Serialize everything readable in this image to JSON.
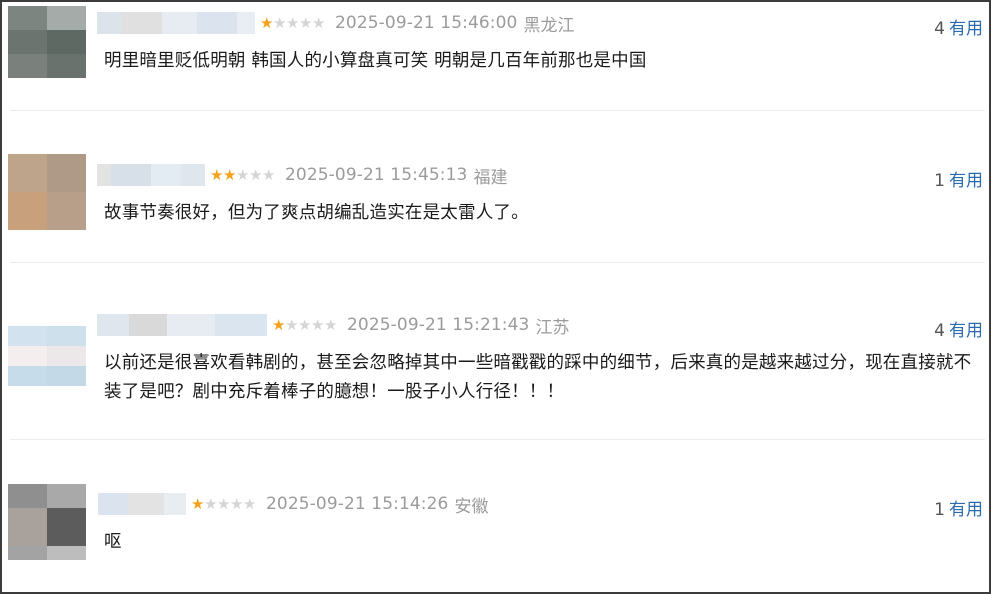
{
  "useful_label": "有用",
  "colors": {
    "star_on": "#f4a21b",
    "star_off": "#d5d5d5",
    "meta_text": "#9b9b9b",
    "link": "#2a6bb0",
    "border": "#3c3c3c"
  },
  "reviews": [
    {
      "stars": 1,
      "time": "2025-09-21 15:46:00",
      "location": "黑龙江",
      "useful_count": "4",
      "content": "明里暗里贬低明朝 韩国人的小算盘真可笑 明朝是几百年前那也是中国",
      "avatar": [
        "#7d8580",
        "#a5aba8",
        "#6c7470",
        "#5f6964",
        "#7a817d",
        "#6a726e"
      ],
      "username_blur": [
        "#dde3ea",
        "#e0e0e0",
        "#e6ecf2",
        "#dbe4ee",
        "#e8eef3"
      ]
    },
    {
      "stars": 2,
      "time": "2025-09-21 15:45:13",
      "location": "福建",
      "useful_count": "1",
      "content": "故事节奏很好，但为了爽点胡编乱造实在是太雷人了。",
      "avatar": [
        "#bfa48c",
        "#ae9a86",
        "#c9a07c",
        "#b79f8a"
      ],
      "username_blur": [
        "#e3e3e3",
        "#d7dfe8",
        "#e4ecf3",
        "#dfe6ee"
      ]
    },
    {
      "stars": 1,
      "time": "2025-09-21 15:21:43",
      "location": "江苏",
      "useful_count": "4",
      "content": "以前还是很喜欢看韩剧的，甚至会忽略掉其中一些暗戳戳的踩中的细节，后来真的是越来越过分，现在直接就不装了是吧？剧中充斥着棒子的臆想！一股子小人行径！！！",
      "avatar": [
        "#d2e3ef",
        "#cde0ec",
        "#f4eeee",
        "#ece7e8",
        "#c7dcea",
        "#c4d9e8"
      ],
      "username_blur": [
        "#dfe6ee",
        "#d9d9d9",
        "#e6ecf1",
        "#dbe5ef"
      ]
    },
    {
      "stars": 1,
      "time": "2025-09-21 15:14:26",
      "location": "安徽",
      "useful_count": "1",
      "content": "呕",
      "avatar": [
        "#8f8f8f",
        "#a9a9a9",
        "#a9a19b",
        "#5c5c5c",
        "#a3a3a3",
        "#bdbdbd"
      ],
      "username_blur": [
        "#dbe4ee",
        "#e3e3e3",
        "#e8edf2"
      ]
    }
  ]
}
